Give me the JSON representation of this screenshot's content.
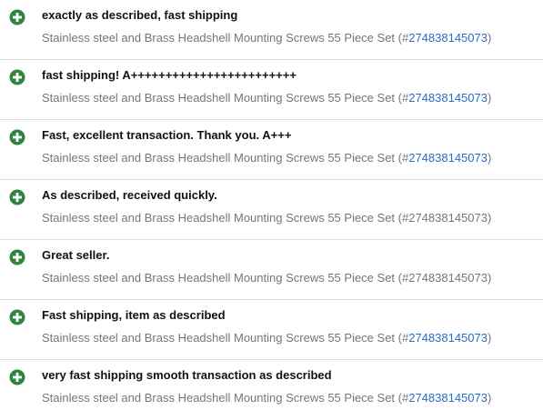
{
  "feedback": {
    "positive_icon": "plus-circle-icon",
    "accent_color": "#2e8540",
    "link_color": "#2b6cc4",
    "entries": [
      {
        "comment": "exactly as described, fast shipping",
        "item_title": "Stainless steel and Brass Headshell Mounting Screws 55 Piece Set",
        "item_prefix": " (#",
        "item_id": "274838145073",
        "item_suffix": ")"
      },
      {
        "comment": "fast shipping! A++++++++++++++++++++++++",
        "item_title": "Stainless steel and Brass Headshell Mounting Screws 55 Piece Set",
        "item_prefix": " (#",
        "item_id": "274838145073",
        "item_suffix": ")"
      },
      {
        "comment": "Fast, excellent transaction. Thank you. A+++",
        "item_title": "Stainless steel and Brass Headshell Mounting Screws 55 Piece Set",
        "item_prefix": " (#",
        "item_id": "274838145073",
        "item_suffix": ")"
      },
      {
        "comment": "As described, received quickly.",
        "item_title": "Stainless steel and Brass Headshell Mounting Screws 55 Piece Set (#274838145073)",
        "item_prefix": "",
        "item_id": "",
        "item_suffix": ""
      },
      {
        "comment": "Great seller.",
        "item_title": "Stainless steel and Brass Headshell Mounting Screws 55 Piece Set (#274838145073)",
        "item_prefix": "",
        "item_id": "",
        "item_suffix": ""
      },
      {
        "comment": "Fast shipping, item as described",
        "item_title": "Stainless steel and Brass Headshell Mounting Screws 55 Piece Set",
        "item_prefix": " (#",
        "item_id": "274838145073",
        "item_suffix": ")"
      },
      {
        "comment": "very fast shipping smooth transaction as described",
        "item_title": "Stainless steel and Brass Headshell Mounting Screws 55 Piece Set",
        "item_prefix": " (#",
        "item_id": "274838145073",
        "item_suffix": ")"
      }
    ]
  }
}
